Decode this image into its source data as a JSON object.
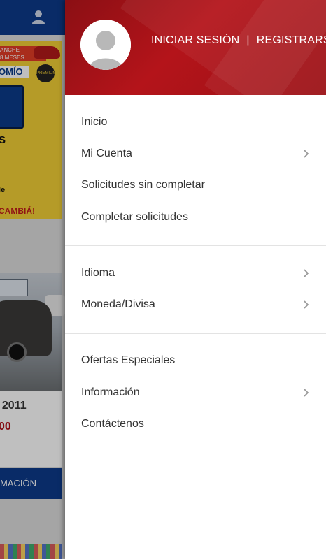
{
  "background_page": {
    "promo_text": "ANCHE\n8 MESES",
    "brand_text": "OMÍO",
    "badge_text": "PREMIUM",
    "headline_fragment": "S",
    "line_fragment": "le",
    "cta_fragment": "CAMBIÁ!",
    "listing_year": ". 2011",
    "listing_price": "00",
    "button_fragment": "MACIÓN"
  },
  "drawer": {
    "header": {
      "login_label": "INICIAR SESIÓN",
      "separator": "|",
      "register_label": "REGISTRARSE",
      "avatar_icon": "user-avatar-icon"
    },
    "groups": [
      {
        "items": [
          {
            "label": "Inicio",
            "has_submenu": false
          },
          {
            "label": "Mi Cuenta",
            "has_submenu": true
          },
          {
            "label": "Solicitudes sin completar",
            "has_submenu": false
          },
          {
            "label": "Completar solicitudes",
            "has_submenu": false
          }
        ]
      },
      {
        "items": [
          {
            "label": "Idioma",
            "has_submenu": true
          },
          {
            "label": "Moneda/Divisa",
            "has_submenu": true
          }
        ]
      },
      {
        "items": [
          {
            "label": "Ofertas Especiales",
            "has_submenu": false
          },
          {
            "label": "Información",
            "has_submenu": true
          },
          {
            "label": "Contáctenos",
            "has_submenu": false
          }
        ]
      }
    ]
  },
  "colors": {
    "header_red": "#b4141a",
    "topbar_blue": "#0d3a8a",
    "menu_text": "#333333",
    "chevron": "#9a9a9a"
  }
}
